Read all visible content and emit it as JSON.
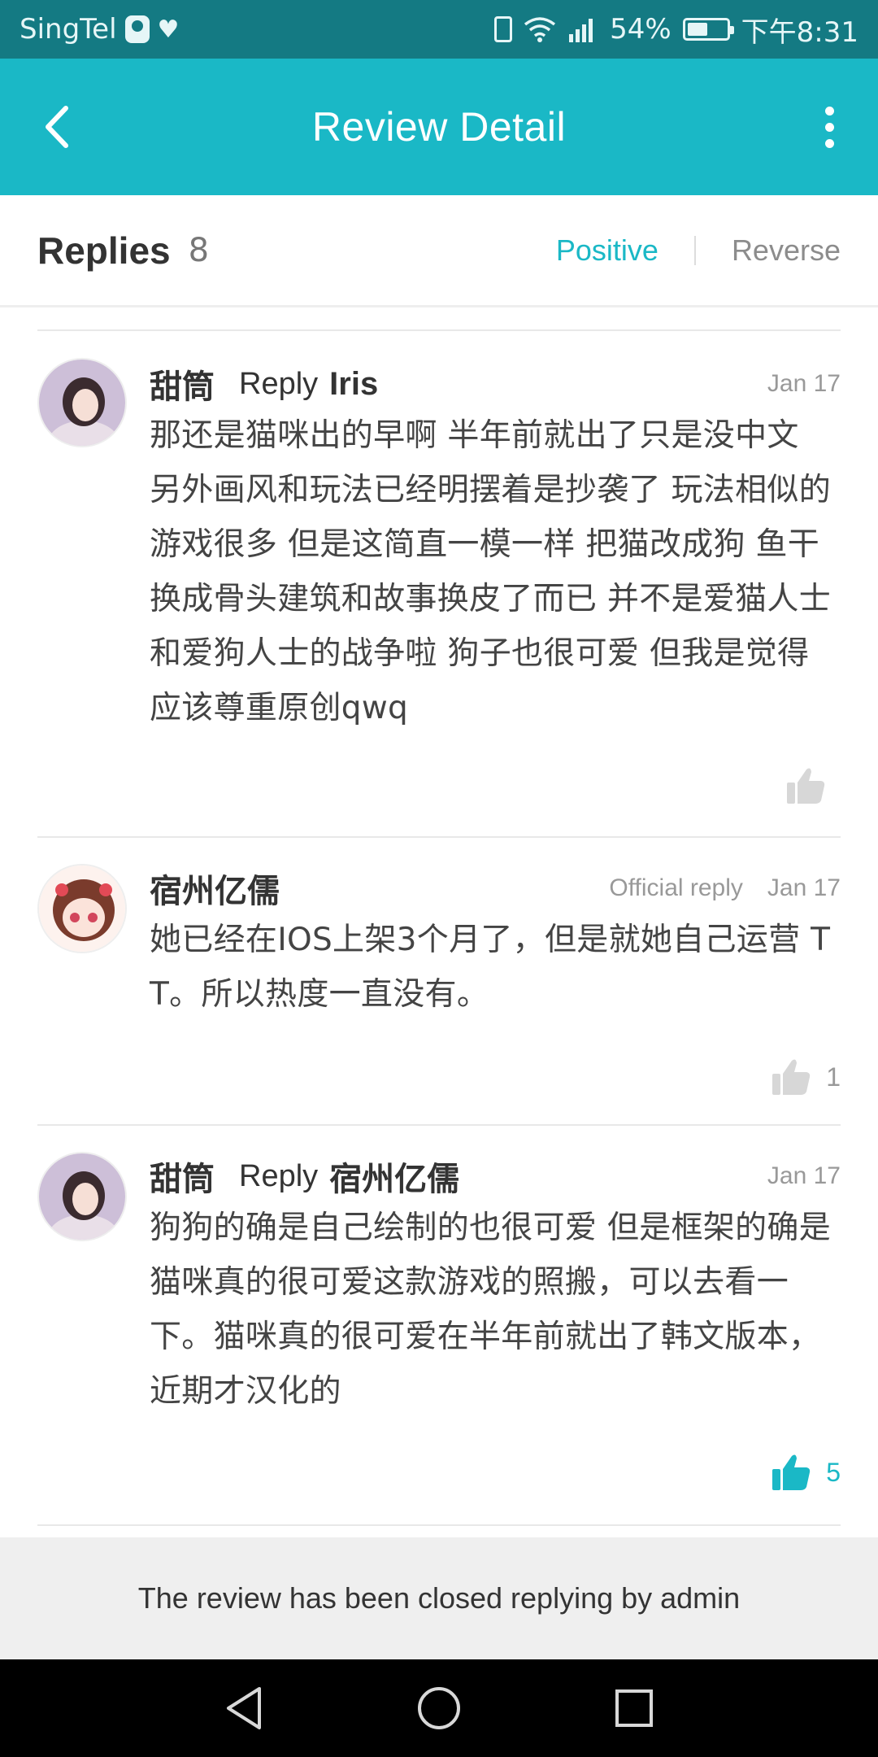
{
  "status_bar": {
    "carrier": "SingTel",
    "battery_text": "54%",
    "battery_level": 0.54,
    "time": "下午8:31",
    "icons": [
      "qq-icon",
      "heart-icon",
      "vibrate-icon",
      "wifi-icon",
      "signal-icon",
      "battery-icon"
    ]
  },
  "header": {
    "title": "Review Detail",
    "back_icon": "chevron-left-icon",
    "more_icon": "more-vertical-icon"
  },
  "replies_bar": {
    "title": "Replies",
    "count": "8",
    "sort_options": [
      "Positive",
      "Reverse"
    ],
    "active_sort": "Positive"
  },
  "replies": [
    {
      "author": "甜筒",
      "reply_label": "Reply",
      "reply_to": "Iris",
      "official_label": "",
      "date": "Jan 17",
      "text": "那还是猫咪出的早啊 半年前就出了只是没中文 另外画风和玩法已经明摆着是抄袭了 玩法相似的游戏很多 但是这简直一模一样 把猫改成狗 鱼干换成骨头建筑和故事换皮了而已 并不是爱猫人士和爱狗人士的战争啦 狗子也很可爱 但我是觉得应该尊重原创qwq",
      "likes": "",
      "liked": false
    },
    {
      "author": "宿州亿儒",
      "reply_label": "",
      "reply_to": "",
      "official_label": "Official reply",
      "date": "Jan 17",
      "text": "她已经在IOS上架3个月了，但是就她自己运营 T T。所以热度一直没有。",
      "likes": "1",
      "liked": false
    },
    {
      "author": "甜筒",
      "reply_label": "Reply",
      "reply_to": "宿州亿儒",
      "official_label": "",
      "date": "Jan 17",
      "text": "狗狗的确是自己绘制的也很可爱 但是框架的确是猫咪真的很可爱这款游戏的照搬，可以去看一下。猫咪真的很可爱在半年前就出了韩文版本，近期才汉化的",
      "likes": "5",
      "liked": true
    }
  ],
  "closed_notice": "The review has been closed replying by admin",
  "nav_bar": {
    "icons": [
      "back-triangle-icon",
      "home-circle-icon",
      "recents-square-icon"
    ]
  },
  "colors": {
    "accent": "#1ab8c6",
    "status_bar": "#147a83",
    "muted_text": "#999999"
  }
}
